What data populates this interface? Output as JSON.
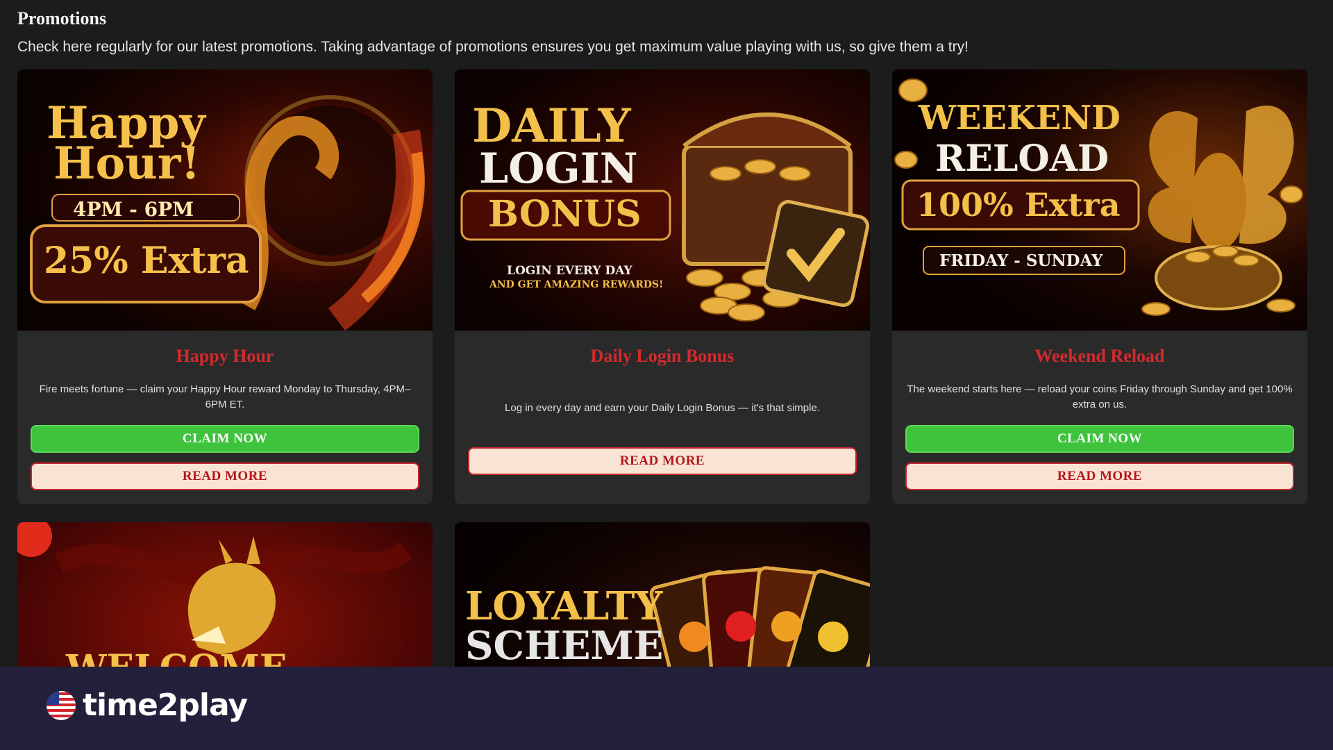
{
  "page": {
    "title": "Promotions",
    "intro": "Check here regularly for our latest promotions. Taking advantage of promotions ensures you get maximum value playing with us, so give them a try!"
  },
  "cards": [
    {
      "banner": {
        "line1": "Happy",
        "line2": "Hour!",
        "time": "4PM - 6PM",
        "extra": "25% Extra"
      },
      "title": "Happy Hour",
      "desc": "Fire meets fortune — claim your Happy Hour reward Monday to Thursday, 4PM–6PM ET.",
      "claim": "CLAIM NOW",
      "read": "READ MORE"
    },
    {
      "banner": {
        "line1": "DAILY",
        "line2": "LOGIN",
        "line3": "BONUS",
        "sub1": "LOGIN EVERY DAY",
        "sub2": "AND GET AMAZING REWARDS!"
      },
      "title": "Daily Login Bonus",
      "desc": "Log in every day and earn your Daily Login Bonus — it's that simple.",
      "read": "READ MORE"
    },
    {
      "banner": {
        "line1": "WEEKEND",
        "line2": "RELOAD",
        "extra": "100% Extra",
        "days": "FRIDAY - SUNDAY"
      },
      "title": "Weekend Reload",
      "desc": "The weekend starts here — reload your coins Friday through Sunday and get 100% extra on us.",
      "claim": "CLAIM NOW",
      "read": "READ MORE"
    },
    {
      "banner": {
        "line1": "WELCOME OFFER"
      }
    },
    {
      "banner": {
        "line1": "LOYALTY",
        "line2": "SCHEME"
      }
    }
  ],
  "footer": {
    "logo_text": "time2play"
  },
  "colors": {
    "claim_green": "#3fc23c",
    "title_red": "#d32a2e",
    "read_bg": "#f9e3d3",
    "footer_bg": "#22203b"
  }
}
